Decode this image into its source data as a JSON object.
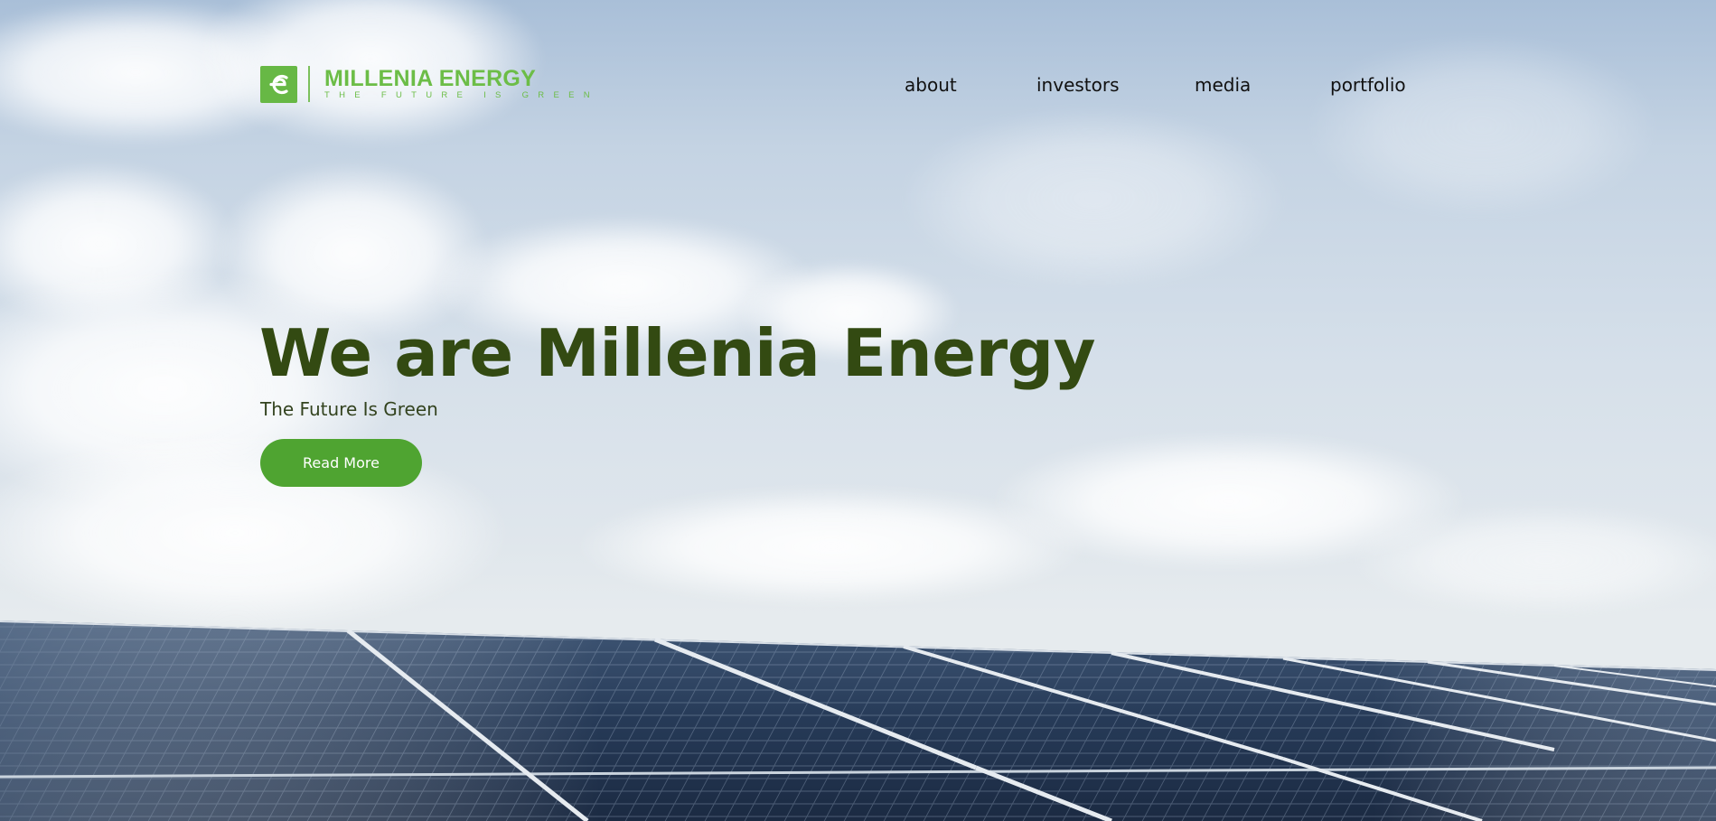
{
  "header": {
    "logo": {
      "name": "MILLENIA ENERGY",
      "tagline": "THE FUTURE IS GREEN",
      "icon": "millenia-e-logo-icon"
    },
    "nav": [
      {
        "label": "about"
      },
      {
        "label": "investors"
      },
      {
        "label": "media"
      },
      {
        "label": "portfolio"
      }
    ]
  },
  "hero": {
    "headline": "We are Millenia Energy",
    "subtitle": "The Future Is Green",
    "cta_label": "Read More",
    "background": "sky-with-clouds-and-solar-panels-photo"
  },
  "colors": {
    "brand_green": "#6cbd47",
    "button_green": "#4fa431",
    "headline_green": "#334a12",
    "nav_text": "#111111"
  }
}
